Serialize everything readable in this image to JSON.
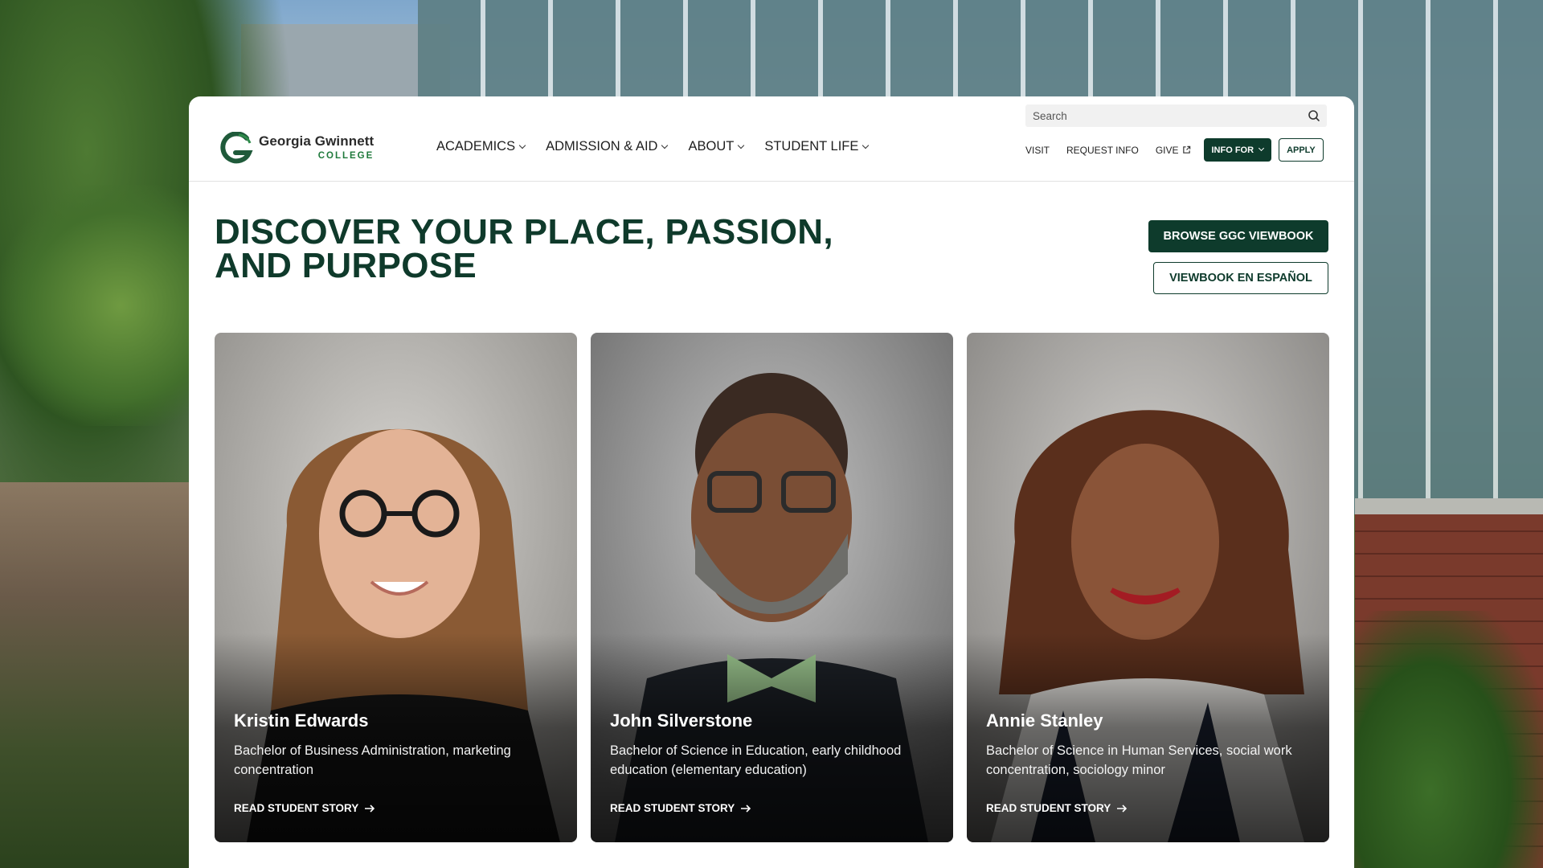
{
  "brand": {
    "name": "Georgia Gwinnett",
    "subname": "COLLEGE",
    "primary_color": "#0e3b2c",
    "accent_color": "#1f7a3c"
  },
  "header": {
    "search": {
      "placeholder": "Search"
    },
    "main_nav": [
      {
        "label": "ACADEMICS"
      },
      {
        "label": "ADMISSION & AID"
      },
      {
        "label": "ABOUT"
      },
      {
        "label": "STUDENT LIFE"
      }
    ],
    "utility_nav": {
      "visit": "VISIT",
      "request_info": "REQUEST INFO",
      "give": "GIVE",
      "info_for": "INFO FOR",
      "apply": "APPLY"
    }
  },
  "hero": {
    "title_line1": "DISCOVER YOUR PLACE, PASSION,",
    "title_line2": "AND PURPOSE",
    "viewbook_button": "BROWSE GGC VIEWBOOK",
    "espanol_button": "VIEWBOOK EN ESPAÑOL"
  },
  "stories": [
    {
      "name": "Kristin Edwards",
      "degree": "Bachelor of Business Administration, marketing concentration",
      "link": "READ STUDENT STORY"
    },
    {
      "name": "John Silverstone",
      "degree": "Bachelor of Science in Education, early childhood education (elementary education)",
      "link": "READ STUDENT STORY"
    },
    {
      "name": "Annie Stanley",
      "degree": "Bachelor of Science in Human Services, social work concentration, sociology minor",
      "link": "READ STUDENT STORY"
    }
  ]
}
